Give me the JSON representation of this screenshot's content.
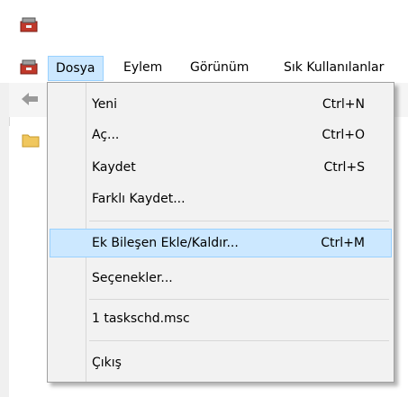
{
  "menubar": {
    "items": [
      {
        "label": "Dosya"
      },
      {
        "label": "Eylem"
      },
      {
        "label": "Görünüm"
      },
      {
        "label": "Sık Kullanılanlar"
      }
    ]
  },
  "dropdown": {
    "items": [
      {
        "label": "Yeni",
        "shortcut": "Ctrl+N"
      },
      {
        "label": "Aç...",
        "shortcut": "Ctrl+O"
      },
      {
        "label": "Kaydet",
        "shortcut": "Ctrl+S"
      },
      {
        "label": "Farklı Kaydet...",
        "shortcut": ""
      },
      {
        "label": "Ek Bileşen Ekle/Kaldır...",
        "shortcut": "Ctrl+M"
      },
      {
        "label": "Seçenekler...",
        "shortcut": ""
      },
      {
        "label": "1 taskschd.msc",
        "shortcut": ""
      },
      {
        "label": "Çıkış",
        "shortcut": ""
      }
    ]
  },
  "icons": {
    "app": "toolbox-icon",
    "back": "back-arrow-icon",
    "folder": "folder-icon"
  },
  "colors": {
    "highlight_bg": "#cce8ff",
    "highlight_border": "#99d1ff",
    "menu_bg": "#f2f2f2"
  }
}
